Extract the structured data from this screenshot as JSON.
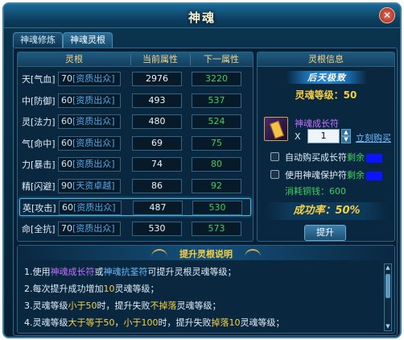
{
  "window": {
    "title": "神魂",
    "close": "✕"
  },
  "tabs": [
    {
      "label": "神魂修炼"
    },
    {
      "label": "神魂灵根"
    }
  ],
  "table": {
    "headers": [
      "灵根",
      "当前属性",
      "下一属性"
    ],
    "rows": [
      {
        "name": "天[气血]",
        "apt_level": "70",
        "apt_text": "[资质出众]",
        "current": "2976",
        "next": "3220"
      },
      {
        "name": "中[防御]",
        "apt_level": "60",
        "apt_text": "[资质出众]",
        "current": "493",
        "next": "537"
      },
      {
        "name": "灵[法力]",
        "apt_level": "60",
        "apt_text": "[资质出众]",
        "current": "480",
        "next": "524"
      },
      {
        "name": "气[命中]",
        "apt_level": "60",
        "apt_text": "[资质出众]",
        "current": "69",
        "next": "75"
      },
      {
        "name": "力[暴击]",
        "apt_level": "60",
        "apt_text": "[资质出众]",
        "current": "74",
        "next": "80"
      },
      {
        "name": "精[闪避]",
        "apt_level": "90",
        "apt_text": "[天资卓越]",
        "current": "86",
        "next": "92"
      },
      {
        "name": "英[攻击]",
        "apt_level": "60",
        "apt_text": "[资质出众]",
        "current": "487",
        "next": "530"
      },
      {
        "name": "命[全抗]",
        "apt_level": "70",
        "apt_text": "[资质出众]",
        "current": "530",
        "next": "573"
      }
    ],
    "selected_row": 6
  },
  "info": {
    "header": "灵根信息",
    "badge": "后天极致",
    "level_text": "灵魂等级：50",
    "item_name": "神魂成长符",
    "qty_prefix": "X",
    "qty": "1",
    "buy_link": "立刻购买",
    "auto_buy_label": "自动购买成长符",
    "auto_buy_left": "剩余",
    "protect_label": "使用神魂保护符",
    "protect_left": "剩余",
    "cost_text": "消耗铜钱：600",
    "rate_text": "成功率：50%",
    "upgrade_button": "提升"
  },
  "help": {
    "title": "提升灵根说明",
    "line1": {
      "a": "1.使用",
      "b": "神魂成长符",
      "c": "或",
      "d": "神魂抗荃符",
      "e": "可提升灵根灵魂等级；"
    },
    "line2": {
      "a": "2.每次提升成功增加",
      "b": "10",
      "c": "灵魂等级；"
    },
    "line3": {
      "a": "3.灵魂等级",
      "b": "小于50",
      "c": "时，提升失败",
      "d": "不掉落",
      "e": "灵魂等级；"
    },
    "line4": {
      "a": "4.灵魂等级",
      "b": "大于等于50",
      "c": "，",
      "d": "小于100",
      "e": "时，提升失败",
      "f": "掉落10",
      "g": "灵魂等级；"
    }
  },
  "colors": {
    "accent_gold": "#f6d042",
    "green": "#3ed060",
    "purple": "#c070ff",
    "blue_link": "#6bc0ff"
  }
}
